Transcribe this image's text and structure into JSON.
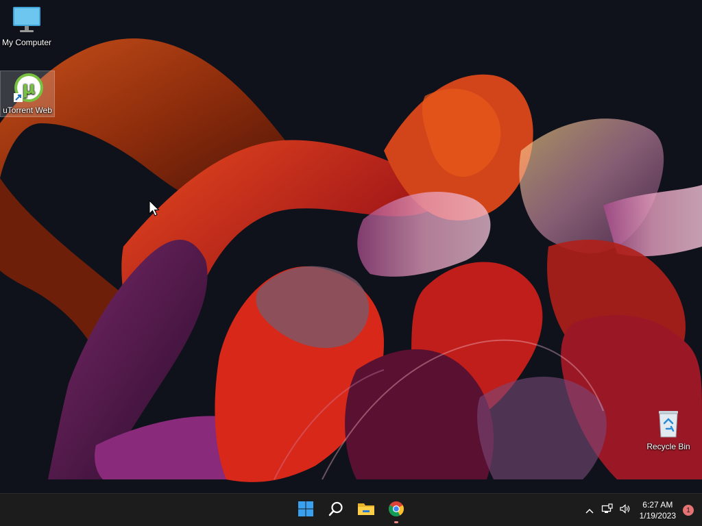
{
  "desktop": {
    "icons": [
      {
        "label": "My Computer"
      },
      {
        "label": "uTorrent Web"
      },
      {
        "label": "Recycle Bin"
      }
    ]
  },
  "taskbar": {
    "apps": [
      {
        "name": "start-icon"
      },
      {
        "name": "search-icon"
      },
      {
        "name": "file-explorer-icon"
      },
      {
        "name": "chrome-icon"
      }
    ],
    "clock": {
      "time": "6:27 AM",
      "date": "1/19/2023"
    },
    "notification_count": "1"
  },
  "colors": {
    "taskbar_bg": "#1c1c1c",
    "desktop_bg": "#0f121b",
    "accent": "#0078d4",
    "badge": "#e57373"
  }
}
